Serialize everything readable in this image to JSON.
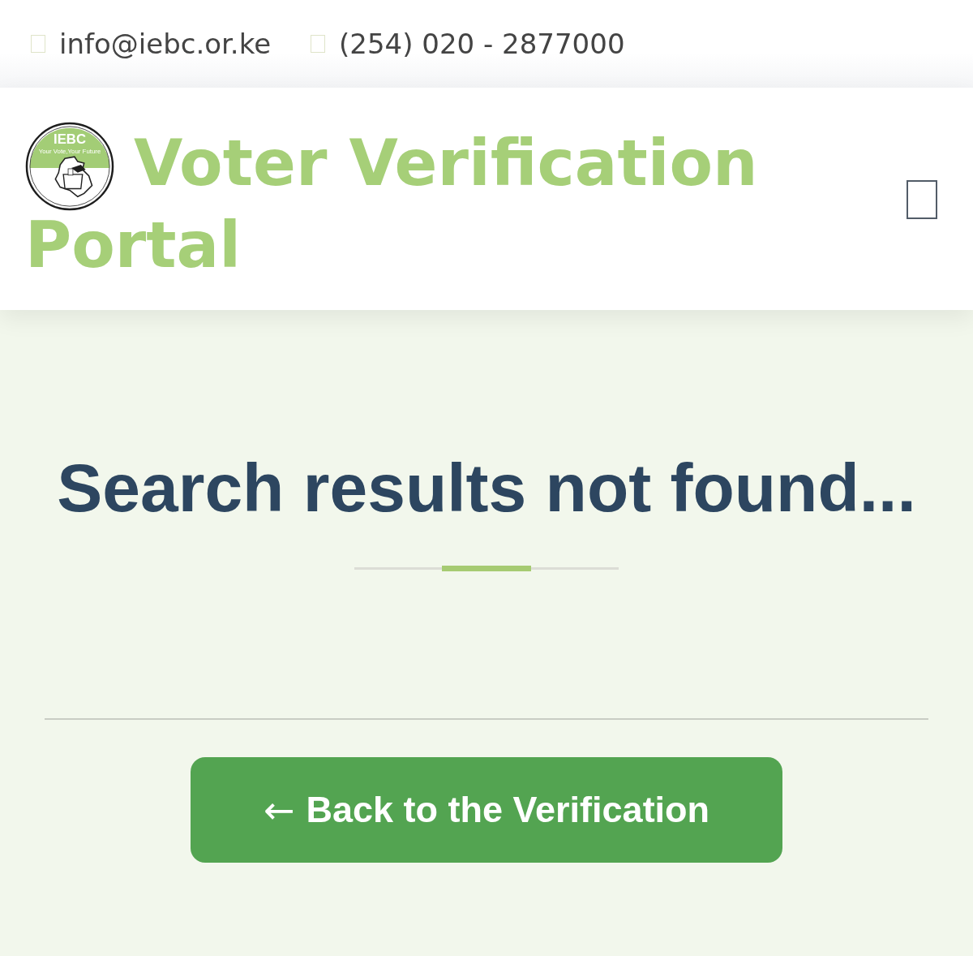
{
  "contact_bar": {
    "items": [
      {
        "text": "info@iebc.or.ke"
      },
      {
        "text": "(254) 020 - 2877000"
      }
    ]
  },
  "header": {
    "logo": {
      "title": "IEBC",
      "tagline": "Your Vote,Your Future"
    },
    "title_lines": [
      "Voter Verification",
      "Portal"
    ]
  },
  "main": {
    "heading": "Search results not found...",
    "button": {
      "icon": "←",
      "label": "Back to the Verification"
    }
  }
}
